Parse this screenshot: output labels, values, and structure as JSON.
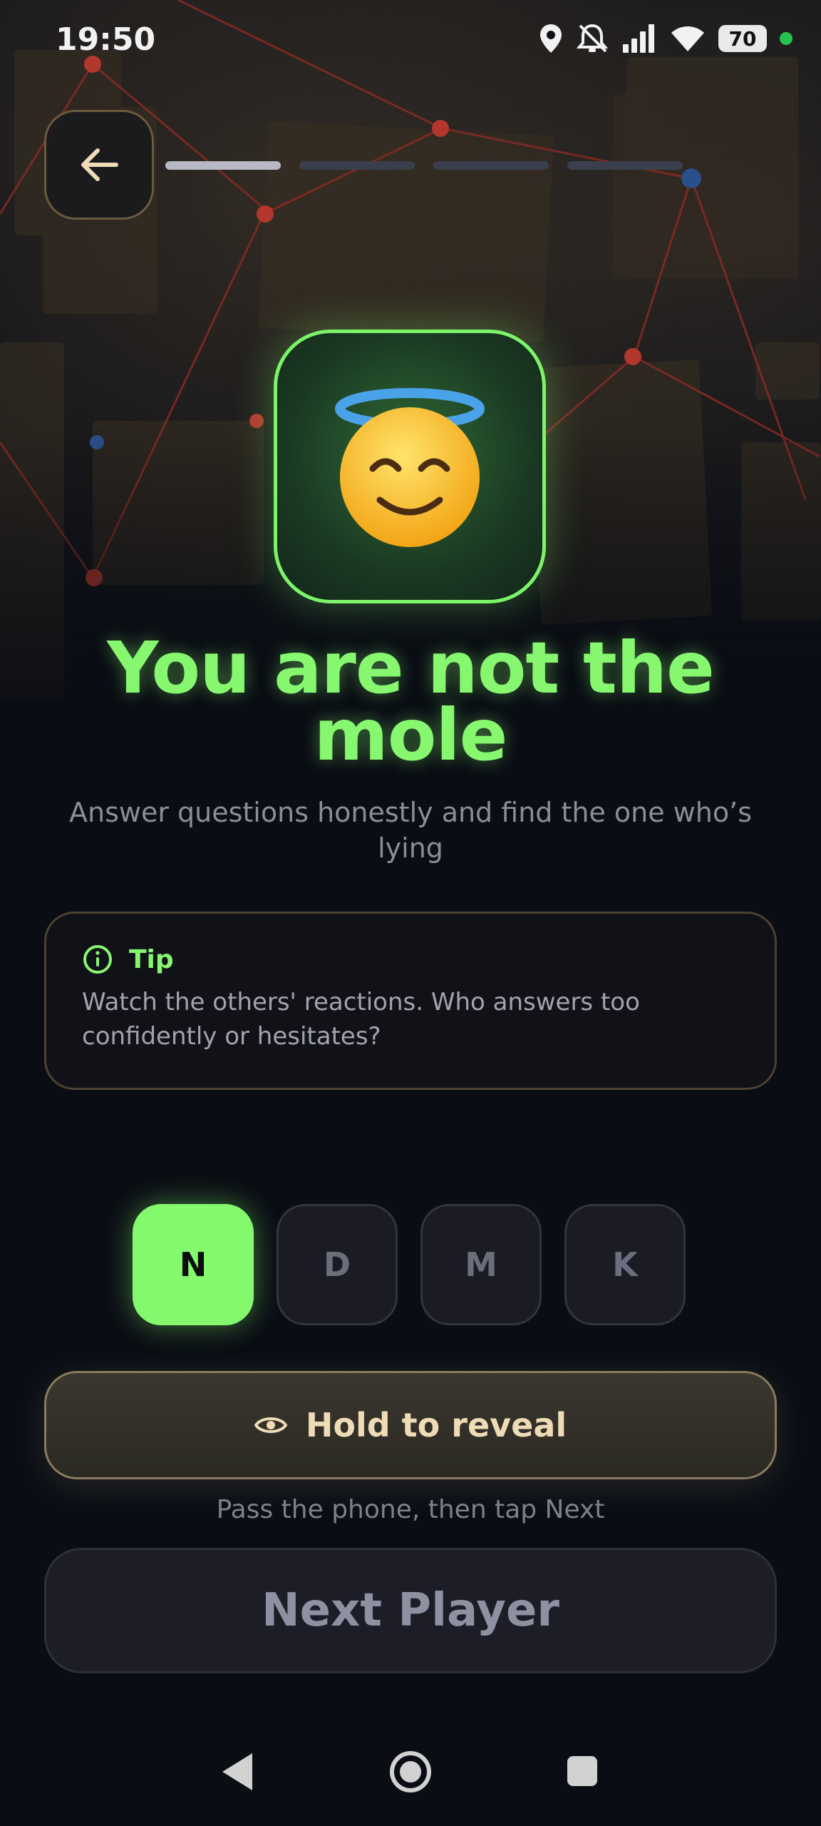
{
  "status_bar": {
    "time": "19:50",
    "battery": "70",
    "icons": [
      "location-icon",
      "muted-bell-icon",
      "signal-icon",
      "wifi-icon",
      "battery-icon"
    ]
  },
  "header": {
    "back_icon": "arrow-left-icon",
    "progress": {
      "total_steps": 4,
      "current_step": 1
    }
  },
  "role": {
    "emoji": "😇",
    "headline": "You are not the mole",
    "description": "Answer questions honestly and find the one who’s lying"
  },
  "tip": {
    "icon": "info-icon",
    "title": "Tip",
    "text": "Watch the others' reactions. Who answers too confidently or hesitates?"
  },
  "players": [
    {
      "label": "N",
      "active": true
    },
    {
      "label": "D",
      "active": false
    },
    {
      "label": "M",
      "active": false
    },
    {
      "label": "K",
      "active": false
    }
  ],
  "actions": {
    "hold_label": "Hold to reveal",
    "hold_icon": "eye-icon",
    "pass_text": "Pass the phone, then tap Next",
    "next_label": "Next Player"
  },
  "colors": {
    "accent_green": "#86f76f",
    "background": "#0a0d14",
    "gold_border": "#8a7b5d"
  }
}
